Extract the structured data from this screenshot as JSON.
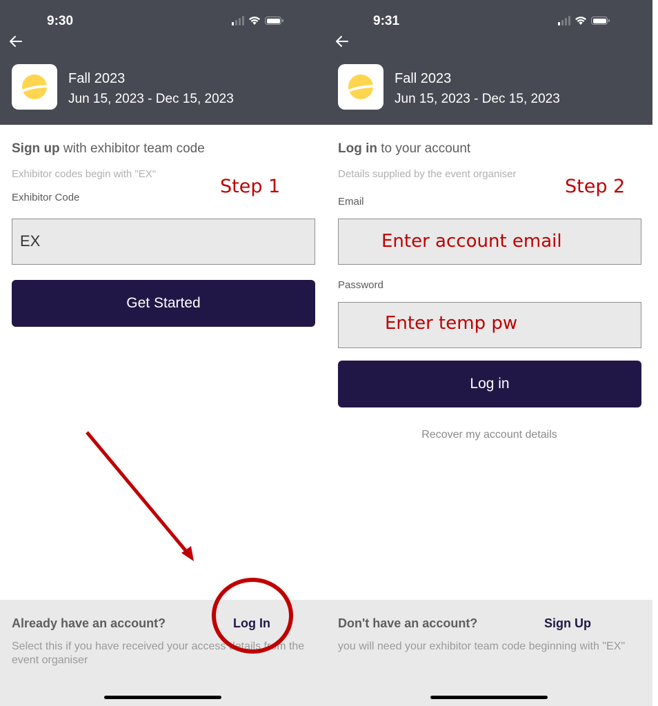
{
  "colors": {
    "header_bg": "#484a53",
    "primary_button": "#211747",
    "logo_sun": "#ffd54f",
    "annotation": "#c00000",
    "footer_bg": "#e9e9e9"
  },
  "event": {
    "name": "Fall 2023",
    "dates": "Jun 15, 2023 - Dec 15, 2023",
    "logo_icon": "sun-logo-icon"
  },
  "screens": [
    {
      "status_bar": {
        "time": "9:30",
        "icons": [
          "cellular-signal-icon",
          "wifi-icon",
          "battery-icon"
        ]
      },
      "back_icon": "arrow-left-icon",
      "title_bold": "Sign up",
      "title_rest": " with exhibitor team code",
      "hint": "Exhibitor codes begin with \"EX\"",
      "field_label": "Exhibitor Code",
      "field_value": "EX",
      "button_label": "Get Started",
      "footer": {
        "question": "Already have an account?",
        "link": "Log In",
        "description": "Select this if you have received your access details from the event organiser"
      },
      "annotation": "Step 1"
    },
    {
      "status_bar": {
        "time": "9:31",
        "icons": [
          "cellular-signal-icon",
          "wifi-icon",
          "battery-icon"
        ]
      },
      "back_icon": "arrow-left-icon",
      "title_bold": "Log in",
      "title_rest": " to your account",
      "hint": "Details supplied by the event organiser",
      "email_label": "Email",
      "email_annotation": "Enter account email",
      "password_label": "Password",
      "password_annotation": "Enter temp pw",
      "button_label": "Log in",
      "recover_link": "Recover my account details",
      "footer": {
        "question": "Don't have an account?",
        "link": "Sign Up",
        "description": "you will need your exhibitor team code beginning with \"EX\""
      },
      "annotation": "Step 2"
    }
  ]
}
